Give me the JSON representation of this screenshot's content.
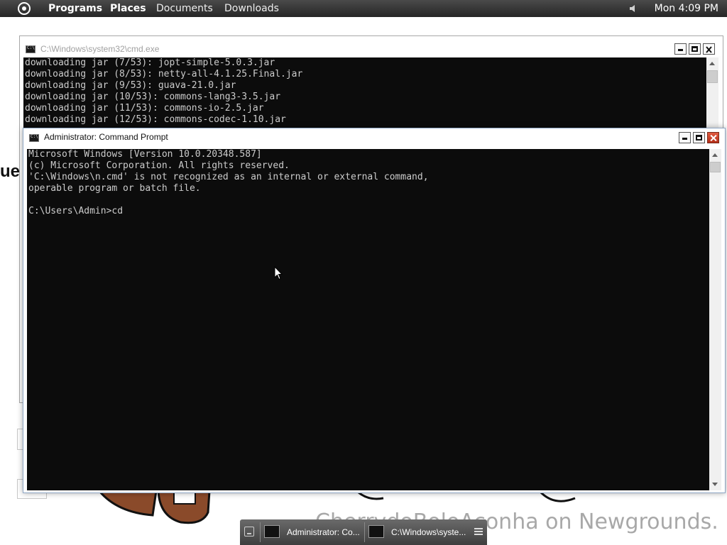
{
  "top_panel": {
    "menu": [
      "Programs",
      "Places",
      "Documents",
      "Downloads"
    ],
    "clock": "Mon 4:09 PM",
    "logo_icon": "gnome-foot-icon",
    "volume_icon": "speaker-icon"
  },
  "desktop": {
    "partial_text": "ue",
    "watermark": "CherrydoBoloAconha on Newgrounds."
  },
  "back_window": {
    "title": "C:\\Windows\\system32\\cmd.exe",
    "lines": [
      "downloading jar (7/53): jopt-simple-5.0.3.jar",
      "downloading jar (8/53): netty-all-4.1.25.Final.jar",
      "downloading jar (9/53): guava-21.0.jar",
      "downloading jar (10/53): commons-lang3-3.5.jar",
      "downloading jar (11/53): commons-io-2.5.jar",
      "downloading jar (12/53): commons-codec-1.10.jar"
    ]
  },
  "front_window": {
    "title": "Administrator: Command Prompt",
    "lines": [
      "Microsoft Windows [Version 10.0.20348.587]",
      "(c) Microsoft Corporation. All rights reserved.",
      "'C:\\Windows\\n.cmd' is not recognized as an internal or external command,",
      "operable program or batch file.",
      "",
      "C:\\Users\\Admin>cd"
    ]
  },
  "taskbar": {
    "items": [
      {
        "label": "Administrator: Co..."
      },
      {
        "label": "C:\\Windows\\syste..."
      }
    ]
  },
  "colors": {
    "console_bg": "#0c0c0c",
    "console_fg": "#cccccc",
    "panel_bg": "#333333",
    "close_button": "#c43c22"
  }
}
